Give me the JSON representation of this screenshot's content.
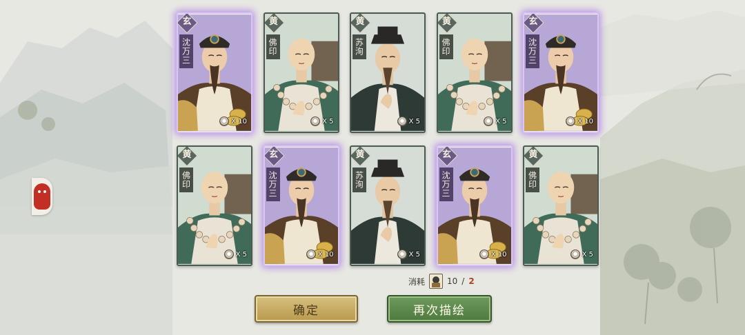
{
  "cards": [
    {
      "grade": "玄",
      "name": "沈万三",
      "count": "X 10",
      "rarity": "purple",
      "character": "merchant"
    },
    {
      "grade": "黄",
      "name": "佛印",
      "count": "X 5",
      "rarity": "normal",
      "character": "monk"
    },
    {
      "grade": "黄",
      "name": "苏洵",
      "count": "X 5",
      "rarity": "normal",
      "character": "scholar"
    },
    {
      "grade": "黄",
      "name": "佛印",
      "count": "X 5",
      "rarity": "normal",
      "character": "monk"
    },
    {
      "grade": "玄",
      "name": "沈万三",
      "count": "X 10",
      "rarity": "purple",
      "character": "merchant"
    },
    {
      "grade": "黄",
      "name": "佛印",
      "count": "X 5",
      "rarity": "normal",
      "character": "monk"
    },
    {
      "grade": "玄",
      "name": "沈万三",
      "count": "X 10",
      "rarity": "purple",
      "character": "merchant"
    },
    {
      "grade": "黄",
      "name": "苏洵",
      "count": "X 5",
      "rarity": "normal",
      "character": "scholar"
    },
    {
      "grade": "玄",
      "name": "沈万三",
      "count": "X 10",
      "rarity": "purple",
      "character": "merchant"
    },
    {
      "grade": "黄",
      "name": "佛印",
      "count": "X 5",
      "rarity": "normal",
      "character": "monk"
    }
  ],
  "cost": {
    "label": "消耗",
    "have": "10",
    "separator": "/",
    "need": "2"
  },
  "buttons": {
    "confirm": "确定",
    "redraw": "再次描绘"
  },
  "colors": {
    "rare_glow": "#a878e6",
    "confirm_button": "#c9ad62",
    "redraw_button": "#5e8a4d",
    "need_red": "#b4401f"
  }
}
